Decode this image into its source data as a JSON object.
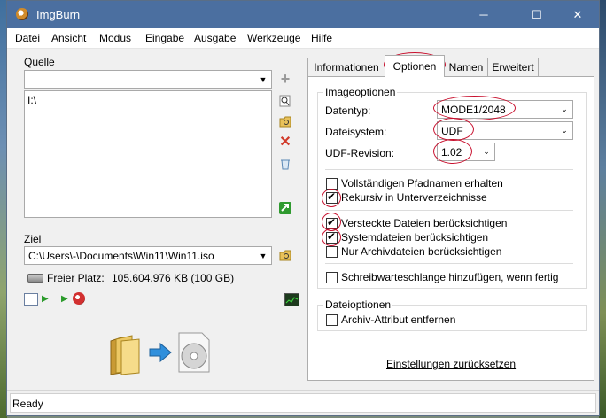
{
  "window": {
    "title": "ImgBurn",
    "minimize_glyph": "─",
    "maximize_glyph": "☐",
    "close_glyph": "✕"
  },
  "menu": [
    "Datei",
    "Ansicht",
    "Modus",
    "Eingabe",
    "Ausgabe",
    "Werkzeuge",
    "Hilfe"
  ],
  "source": {
    "label": "Quelle",
    "combo_value": "",
    "list_items": [
      "I:\\"
    ],
    "side_icons": [
      "add-icon",
      "search-icon",
      "browse-folder-icon",
      "delete-icon",
      "recycle-icon",
      "refresh-icon"
    ]
  },
  "target": {
    "label": "Ziel",
    "path": "C:\\Users\\-\\Documents\\Win11\\Win11.iso",
    "free_space_label": "Freier Platz:",
    "free_space_value": "105.604.976 KB  (100 GB)"
  },
  "tabs": [
    "Informationen",
    "Optionen",
    "Namen",
    "Erweitert"
  ],
  "active_tab": "Optionen",
  "image_options": {
    "group_title": "Imageoptionen",
    "datentyp_label": "Datentyp:",
    "datentyp_value": "MODE1/2048",
    "dateisystem_label": "Dateisystem:",
    "dateisystem_value": "UDF",
    "udf_revision_label": "UDF-Revision:",
    "udf_revision_value": "1.02"
  },
  "checkboxes": [
    {
      "label": "Vollständigen Pfadnamen erhalten",
      "checked": false
    },
    {
      "label": "Rekursiv in Unterverzeichnisse",
      "checked": true
    },
    {
      "label": "Versteckte Dateien berücksichtigen",
      "checked": true
    },
    {
      "label": "Systemdateien berücksichtigen",
      "checked": true
    },
    {
      "label": "Nur Archivdateien berücksichtigen",
      "checked": false
    },
    {
      "label": "Schreibwarteschlange hinzufügen, wenn fertig",
      "checked": false
    }
  ],
  "file_options": {
    "group_title": "Dateioptionen",
    "archive_label": "Archiv-Attribut entfernen",
    "archive_checked": false
  },
  "reset_link": "Einstellungen zurücksetzen",
  "status": "Ready",
  "colors": {
    "titlebar": "#4b6fa0",
    "annotation_red": "#c8102e",
    "window_bg": "#f0f0f0"
  }
}
